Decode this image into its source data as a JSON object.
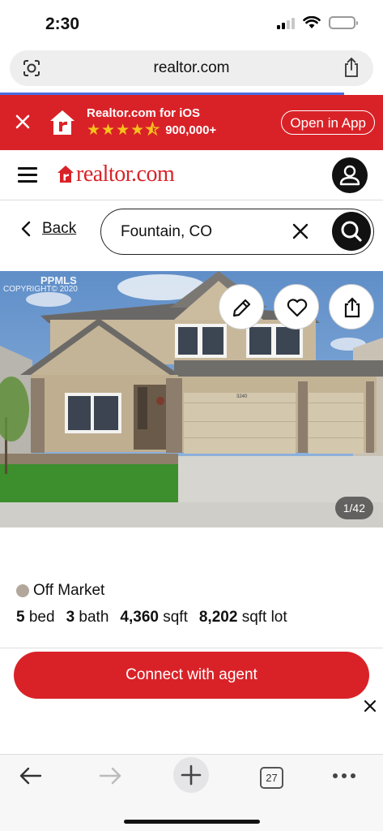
{
  "status_bar": {
    "time": "2:30",
    "battery_level": 0.25
  },
  "browser": {
    "domain": "realtor.com",
    "tab_count": "27"
  },
  "app_banner": {
    "app_name": "Realtor.com for iOS",
    "rating_stars": 4.5,
    "rating_count": "900,000+",
    "open_label": "Open in App",
    "accent_color": "#d92228"
  },
  "header": {
    "logo_text": "realtor.com",
    "brand_color": "#d92228"
  },
  "search": {
    "back_label": "Back",
    "query": "Fountain, CO"
  },
  "photo": {
    "watermark_line1": "PPMLS",
    "watermark_line2": "COPYRIGHT© 2020",
    "house_number": "3240",
    "counter": "1/42"
  },
  "listing": {
    "status": "Off Market",
    "status_color": "#b3a79b",
    "beds_value": "5",
    "beds_label": "bed",
    "baths_value": "3",
    "baths_label": "bath",
    "sqft_value": "4,360",
    "sqft_label": "sqft",
    "lot_value": "8,202",
    "lot_label": "sqft lot"
  },
  "cta": {
    "label": "Connect with agent"
  }
}
